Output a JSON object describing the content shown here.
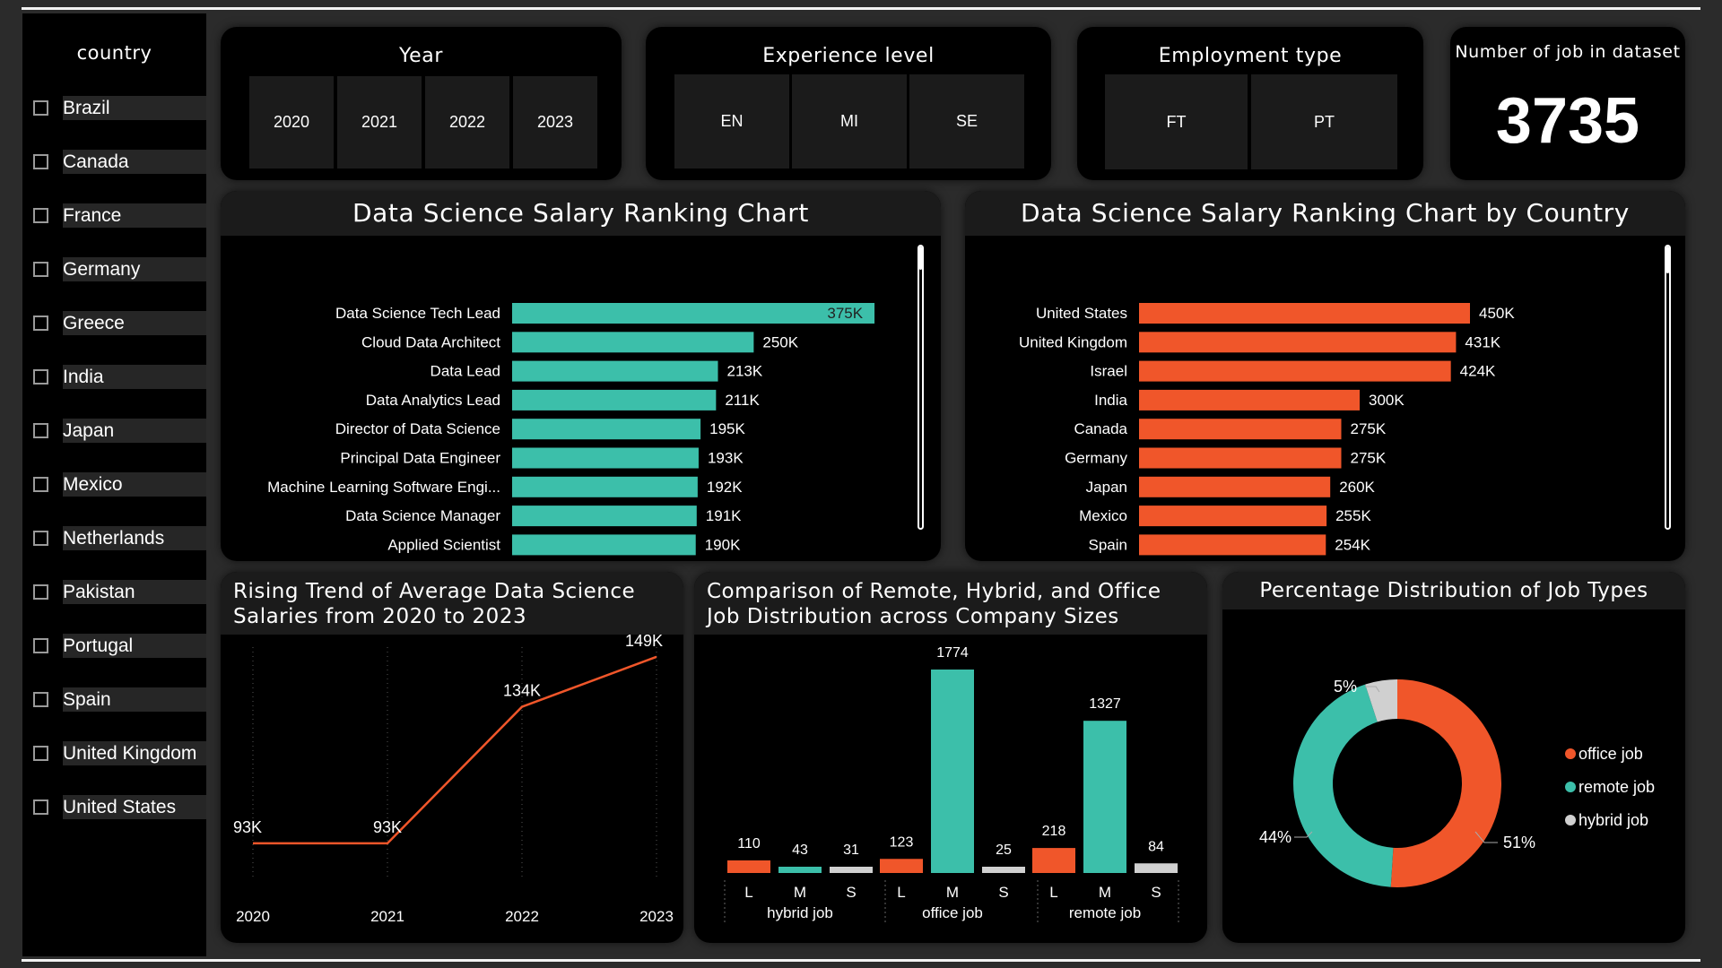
{
  "sidebar": {
    "title": "country",
    "countries": [
      "Brazil",
      "Canada",
      "France",
      "Germany",
      "Greece",
      "India",
      "Japan",
      "Mexico",
      "Netherlands",
      "Pakistan",
      "Portugal",
      "Spain",
      "United Kingdom",
      "United States"
    ]
  },
  "filters": {
    "year": {
      "title": "Year",
      "options": [
        "2020",
        "2021",
        "2022",
        "2023"
      ]
    },
    "experience": {
      "title": "Experience level",
      "options": [
        "EN",
        "MI",
        "SE"
      ]
    },
    "employment": {
      "title": "Employment type",
      "options": [
        "FT",
        "PT"
      ]
    }
  },
  "kpi": {
    "title": "Number of job in dataset",
    "value": "3735"
  },
  "colors": {
    "teal": "#3cbfaa",
    "orange": "#f0562a",
    "gray": "#d0d0d0",
    "card": "#000000",
    "header": "#1b1b1b"
  },
  "chart_data": [
    {
      "type": "bar",
      "orientation": "horizontal",
      "title": "Data Science Salary Ranking Chart",
      "categories": [
        "Data Science Tech Lead",
        "Cloud Data Architect",
        "Data Lead",
        "Data Analytics Lead",
        "Director of Data Science",
        "Principal Data Engineer",
        "Machine Learning Software Engi...",
        "Data Science Manager",
        "Applied Scientist"
      ],
      "values": [
        375000,
        250000,
        213000,
        211000,
        195000,
        193000,
        192000,
        191000,
        190000
      ],
      "labels": [
        "375K",
        "250K",
        "213K",
        "211K",
        "195K",
        "193K",
        "192K",
        "191K",
        "190K"
      ],
      "xticks": [
        "0K",
        "200K",
        "400K"
      ],
      "xlim": [
        0,
        400000
      ],
      "color": "#3cbfaa"
    },
    {
      "type": "bar",
      "orientation": "horizontal",
      "title": "Data Science Salary Ranking Chart by Country",
      "categories": [
        "United States",
        "United Kingdom",
        "Israel",
        "India",
        "Canada",
        "Germany",
        "Japan",
        "Mexico",
        "Spain"
      ],
      "values": [
        450000,
        431000,
        424000,
        300000,
        275000,
        275000,
        260000,
        255000,
        254000
      ],
      "labels": [
        "450K",
        "431K",
        "424K",
        "300K",
        "275K",
        "275K",
        "260K",
        "255K",
        "254K"
      ],
      "xticks": [
        "0K",
        "200K",
        "400K"
      ],
      "xlim": [
        0,
        550000
      ],
      "color": "#f0562a"
    },
    {
      "type": "line",
      "title": "Rising Trend of Average Data Science Salaries from 2020 to 2023",
      "x": [
        "2020",
        "2021",
        "2022",
        "2023"
      ],
      "values": [
        93000,
        93000,
        134000,
        149000
      ],
      "labels": [
        "93K",
        "93K",
        "134K",
        "149K"
      ],
      "color": "#f0562a"
    },
    {
      "type": "bar",
      "title": "Comparison of Remote, Hybrid, and Office Job Distribution across Company Sizes",
      "groups": [
        {
          "name": "hybrid job",
          "sizes": [
            "L",
            "M",
            "S"
          ],
          "values": [
            110,
            43,
            31
          ]
        },
        {
          "name": "office job",
          "sizes": [
            "L",
            "M",
            "S"
          ],
          "values": [
            123,
            1774,
            25
          ]
        },
        {
          "name": "remote job",
          "sizes": [
            "L",
            "M",
            "S"
          ],
          "values": [
            218,
            1327,
            84
          ]
        }
      ],
      "size_colors": {
        "L": "#f0562a",
        "M": "#3cbfaa",
        "S": "#d0d0d0"
      },
      "ylim": [
        0,
        1774
      ]
    },
    {
      "type": "pie",
      "donut": true,
      "title": "Percentage Distribution of Job Types",
      "slices": [
        {
          "name": "office job",
          "value": 51,
          "label": "51%",
          "color": "#f0562a"
        },
        {
          "name": "remote job",
          "value": 44,
          "label": "44%",
          "color": "#3cbfaa"
        },
        {
          "name": "hybrid job",
          "value": 5,
          "label": "5%",
          "color": "#d0d0d0"
        }
      ],
      "legend": "right"
    }
  ]
}
